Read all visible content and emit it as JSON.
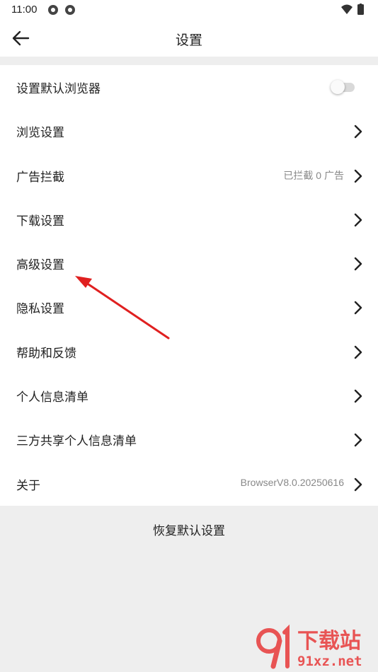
{
  "status": {
    "time": "11:00"
  },
  "header": {
    "title": "设置"
  },
  "settings": {
    "default_browser": {
      "label": "设置默认浏览器",
      "enabled": false
    },
    "items": [
      {
        "label": "浏览设置",
        "value": ""
      },
      {
        "label": "广告拦截",
        "value": "已拦截 0 广告"
      },
      {
        "label": "下载设置",
        "value": ""
      },
      {
        "label": "高级设置",
        "value": ""
      },
      {
        "label": "隐私设置",
        "value": ""
      },
      {
        "label": "帮助和反馈",
        "value": ""
      },
      {
        "label": "个人信息清单",
        "value": ""
      },
      {
        "label": "三方共享个人信息清单",
        "value": ""
      },
      {
        "label": "关于",
        "value": "BrowserV8.0.20250616"
      }
    ]
  },
  "footer": {
    "reset_label": "恢复默认设置"
  },
  "watermark": {
    "brand": "下载站",
    "site": "91xz.net"
  },
  "colors": {
    "annotation_arrow": "#e02020",
    "background": "#eeeeee",
    "surface": "#ffffff"
  }
}
